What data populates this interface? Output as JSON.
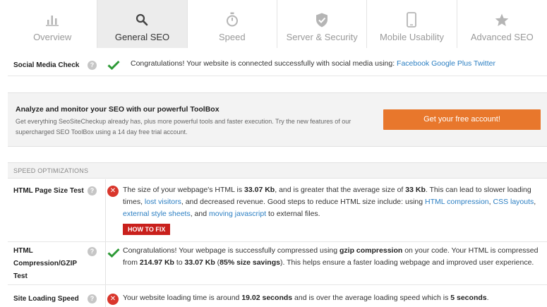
{
  "tabs": [
    {
      "label": "Overview",
      "icon": "bar-chart-icon",
      "active": false
    },
    {
      "label": "General SEO",
      "icon": "search-icon",
      "active": true
    },
    {
      "label": "Speed",
      "icon": "stopwatch-icon",
      "active": false
    },
    {
      "label": "Server & Security",
      "icon": "shield-check-icon",
      "active": false
    },
    {
      "label": "Mobile Usability",
      "icon": "mobile-phone-icon",
      "active": false
    },
    {
      "label": "Advanced SEO",
      "icon": "star-icon",
      "active": false
    }
  ],
  "social": {
    "label": "Social Media Check",
    "text": "Congratulations! Your website is connected successfully with social media using:",
    "links": [
      "Facebook",
      "Google Plus",
      "Twitter"
    ]
  },
  "promo": {
    "title": "Analyze and monitor your SEO with our powerful ToolBox",
    "text": "Get everything SeoSiteCheckup already has, plus more powerful tools and faster execution. Try the new features of our supercharged SEO ToolBox using a 14 day free trial account.",
    "button": "Get your free account!"
  },
  "speed": {
    "heading": "SPEED OPTIMIZATIONS",
    "html_size": {
      "label": "HTML Page Size Test",
      "t1": "The size of your webpage's HTML is ",
      "b1": "33.07 Kb",
      "t2": ", and is greater that the average size of ",
      "b2": "33 Kb",
      "t3": ". This can lead to slower loading times, ",
      "l1": "lost visitors",
      "t4": ", and decreased revenue. Good steps to reduce HTML size include: using ",
      "l2": "HTML compression",
      "t5": ", ",
      "l3": "CSS layouts",
      "t6": ", ",
      "l4": "external style sheets",
      "t7": ", and ",
      "l5": "moving javascript",
      "t8": " to external files.",
      "fix": "HOW TO FIX"
    },
    "gzip": {
      "label_lines": [
        "HTML",
        "Compression/GZIP",
        "Test"
      ],
      "t1": "Congratulations! Your webpage is successfully compressed using ",
      "b1": "gzip compression",
      "t2": " on your code. Your HTML is compressed from ",
      "b2": "214.97 Kb",
      "t3": " to ",
      "b3": "33.07 Kb",
      "t4": " (",
      "b4": "85% size savings",
      "t5": "). This helps ensure a faster loading webpage and improved user experience."
    },
    "loading": {
      "label": "Site Loading Speed",
      "t1": "Your website loading time is around ",
      "b1": "19.02 seconds",
      "t2": " and is over the average loading speed which is ",
      "b2": "5 seconds",
      "t3": "."
    }
  },
  "colors": {
    "accent_orange": "#e8772c",
    "fix_red": "#c9201c",
    "pass_green": "#2e9a37",
    "fail_red": "#d9362c",
    "link_blue": "#2a7ec2"
  }
}
